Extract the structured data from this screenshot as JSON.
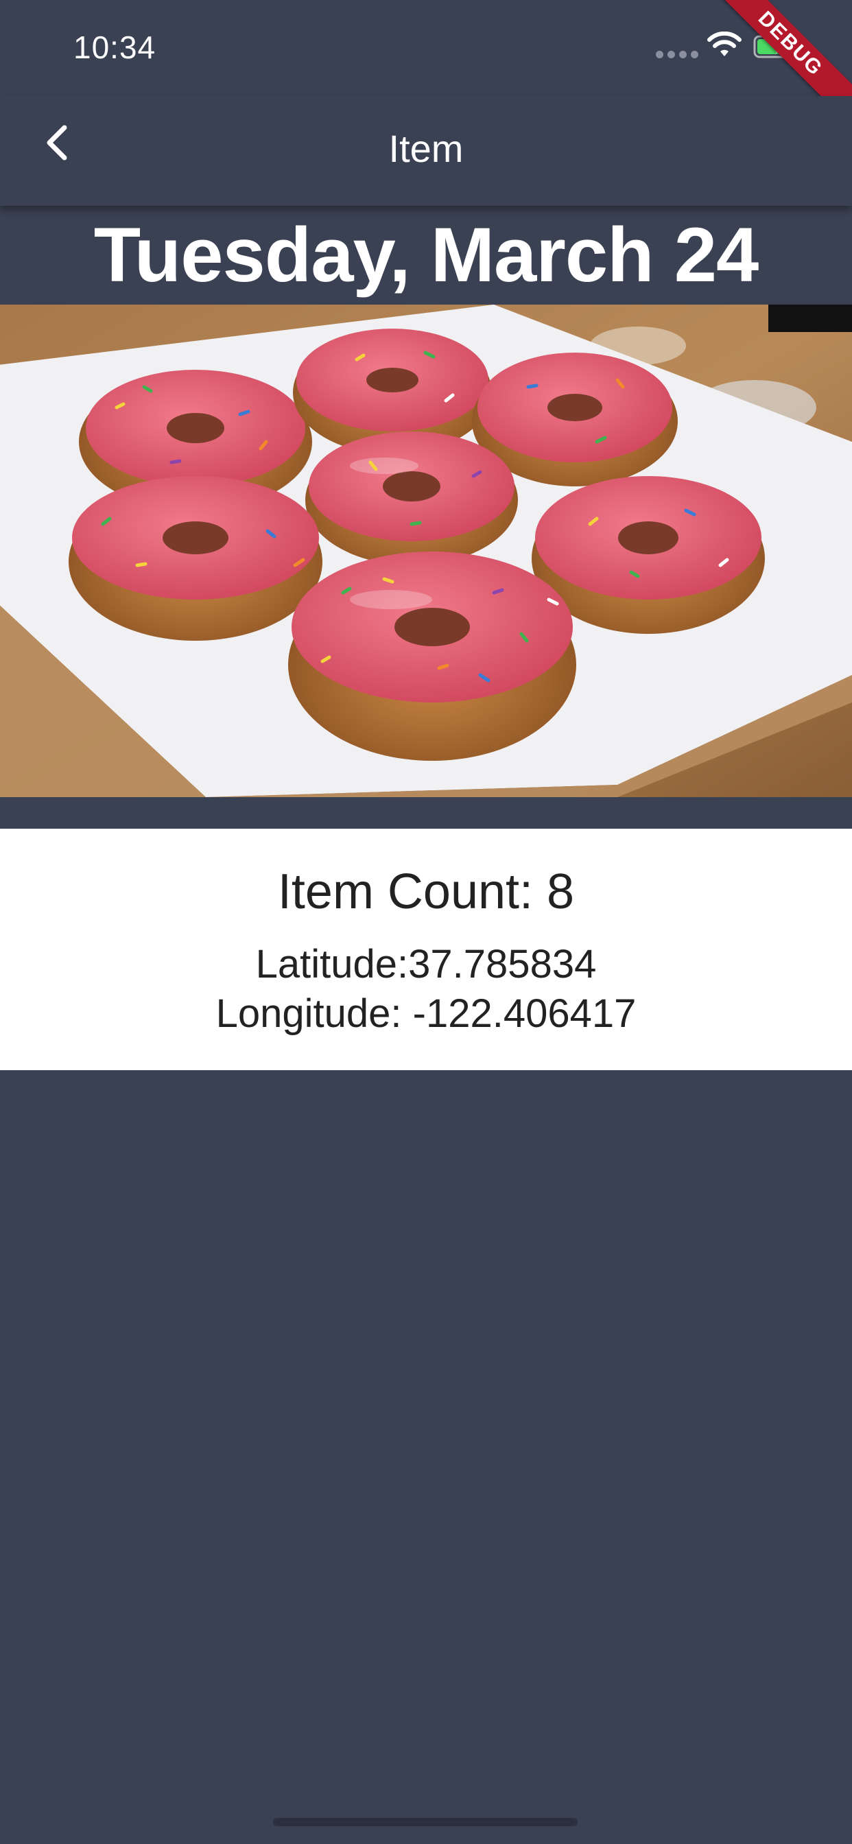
{
  "status_bar": {
    "time": "10:34",
    "wifi_icon": "wifi-icon",
    "battery_icon": "battery-charging-icon"
  },
  "debug_banner": "DEBUG",
  "app_bar": {
    "title": "Item",
    "back_icon": "chevron-left-icon"
  },
  "date_heading": "Tuesday, March 24",
  "photo": {
    "subject": "pink glazed donuts with sprinkles on a white plate"
  },
  "info": {
    "item_count": "Item Count: 8",
    "latitude": "Latitude:37.785834",
    "longitude": "Longitude: -122.406417"
  },
  "colors": {
    "background": "#3a4152",
    "card": "#ffffff",
    "text_dark": "#222222",
    "debug": "#b3182b",
    "icing": "#e05a6e"
  }
}
